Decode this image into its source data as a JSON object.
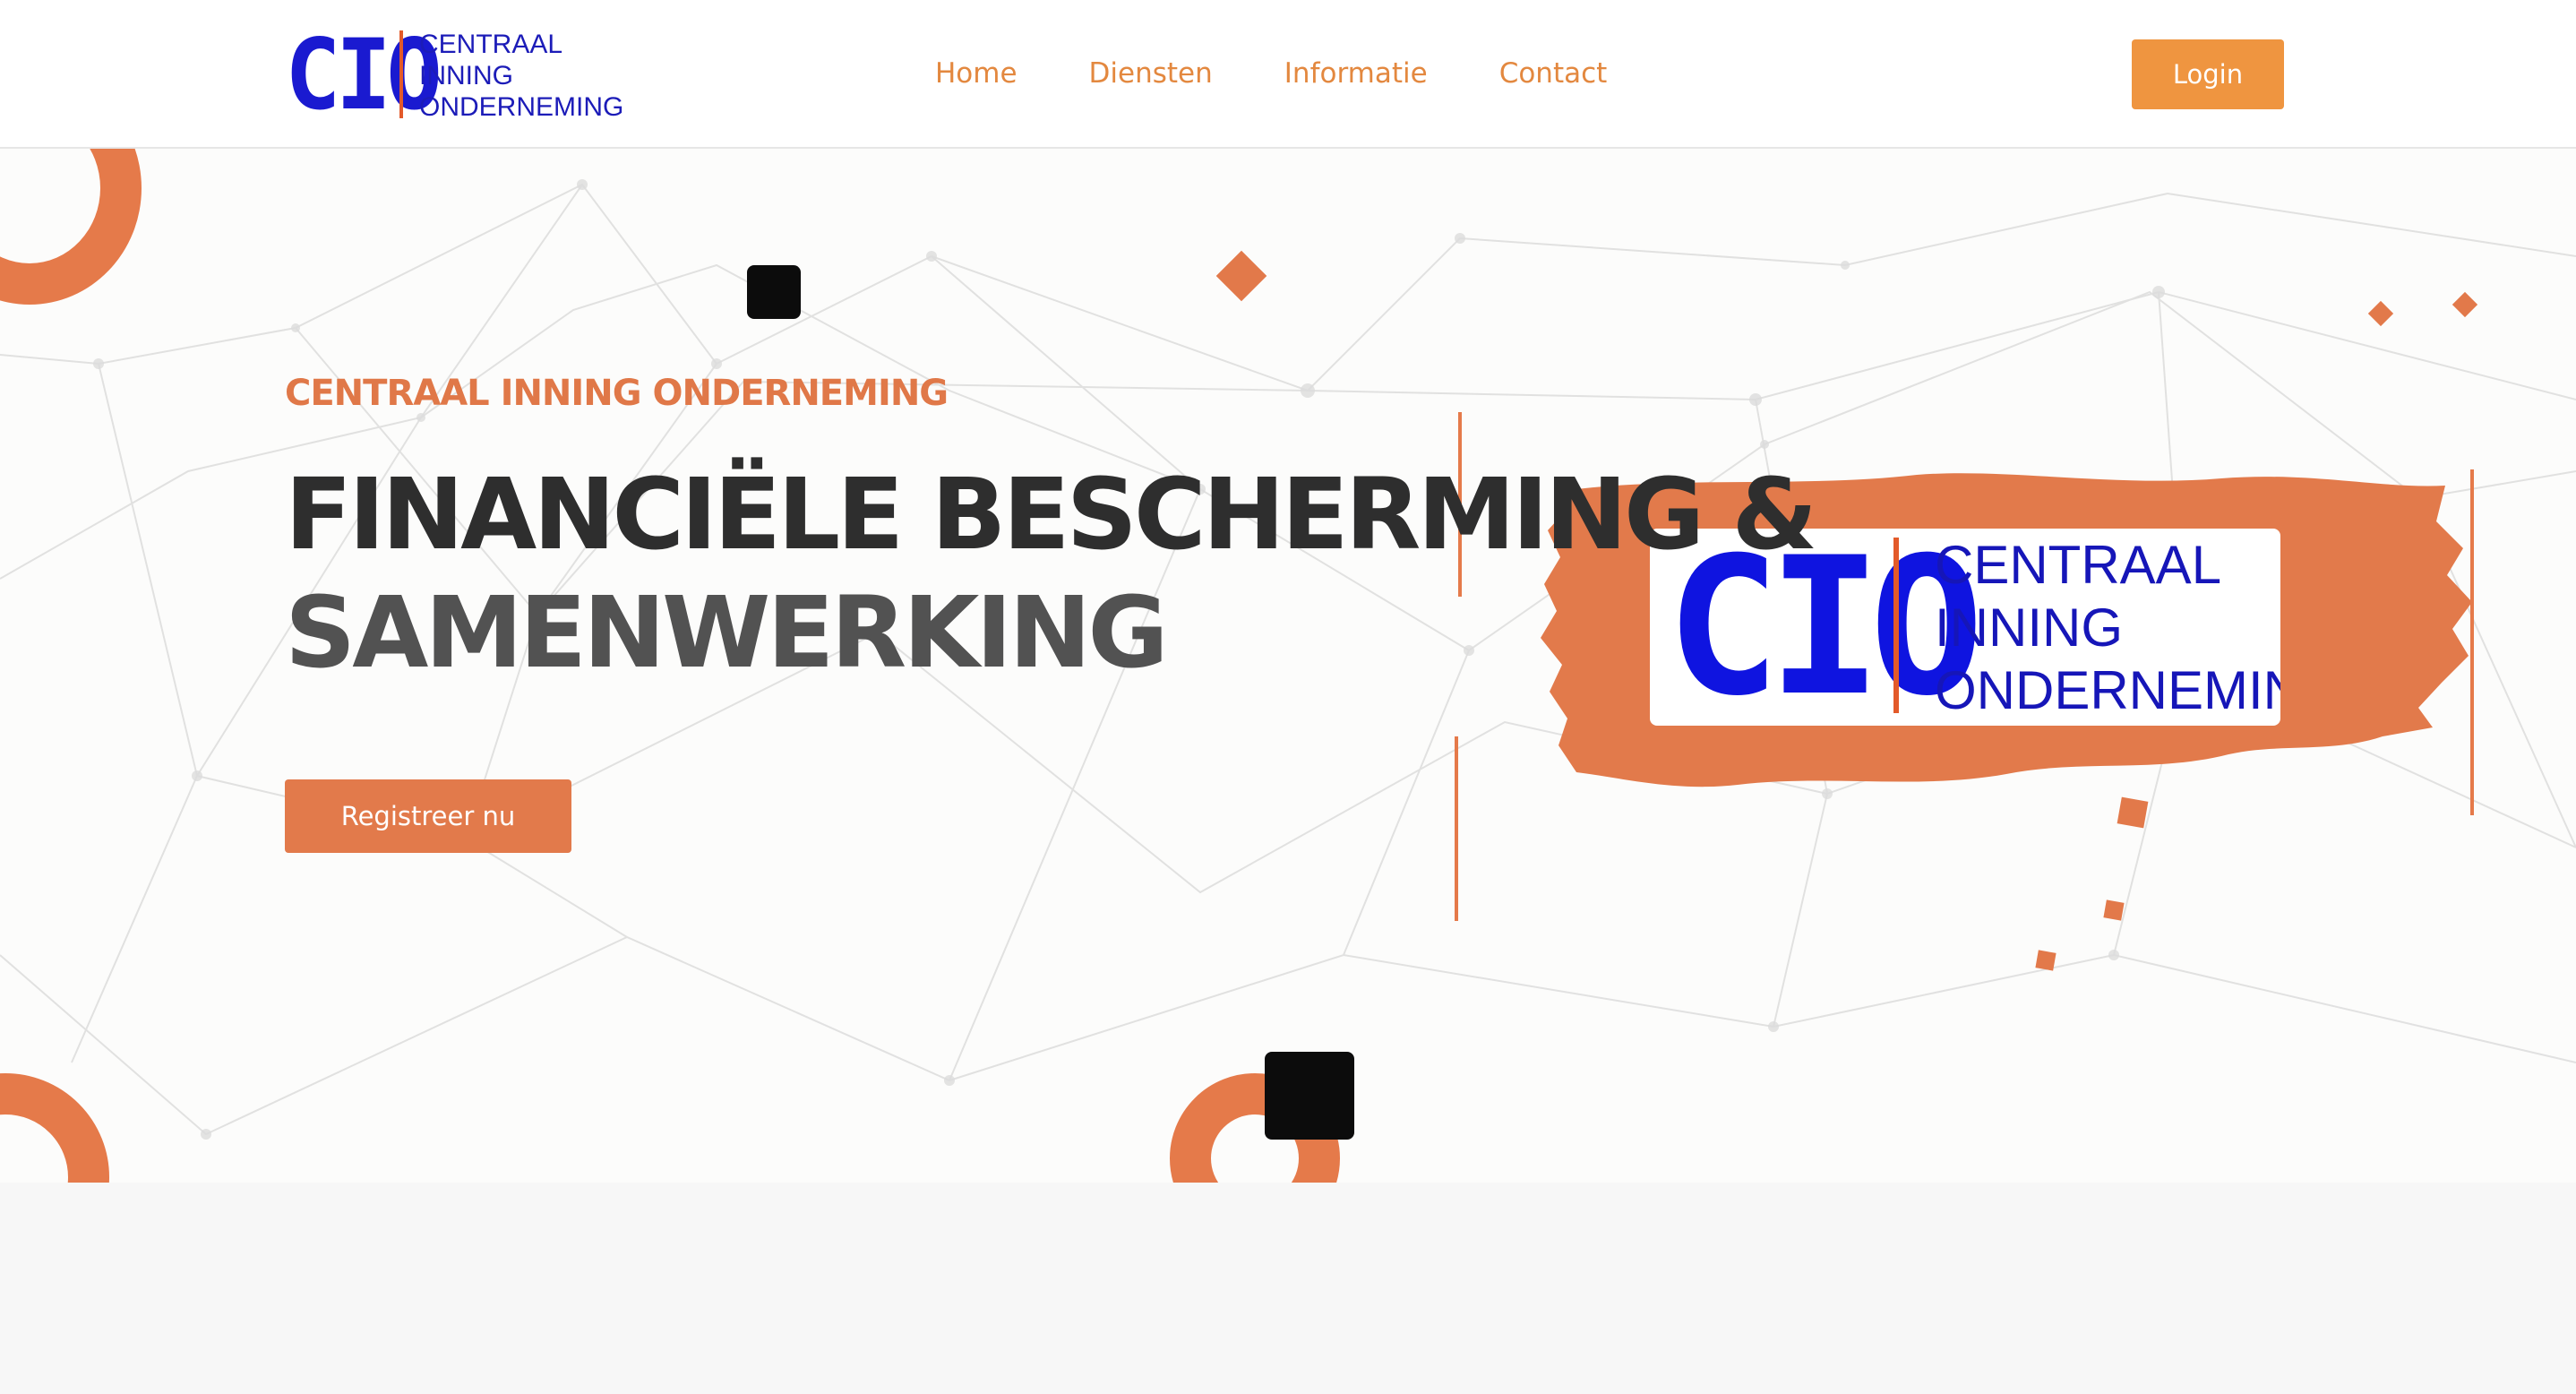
{
  "header": {
    "logo": {
      "mark": "CIO",
      "words": [
        "CENTRAAL",
        "INNING",
        "ONDERNEMING"
      ]
    },
    "nav": [
      {
        "label": "Home"
      },
      {
        "label": "Diensten"
      },
      {
        "label": "Informatie"
      },
      {
        "label": "Contact"
      }
    ],
    "login_label": "Login"
  },
  "hero": {
    "eyebrow": "CENTRAAL INNING ONDERNEMING",
    "headline_line1": "FINANCIËLE BESCHERMING &",
    "headline_line2": "SAMENWERKING",
    "cta_label": "Registreer nu",
    "card_logo": {
      "mark": "CIO",
      "words": [
        "CENTRAAL",
        "INNING",
        "ONDERNEMING"
      ]
    }
  },
  "colors": {
    "accent_orange": "#e27a4b",
    "login_orange": "#ef9540",
    "nav_text": "#e3883f",
    "logo_blue": "#1a1ad0",
    "headline_dark": "#2e2e2e"
  }
}
